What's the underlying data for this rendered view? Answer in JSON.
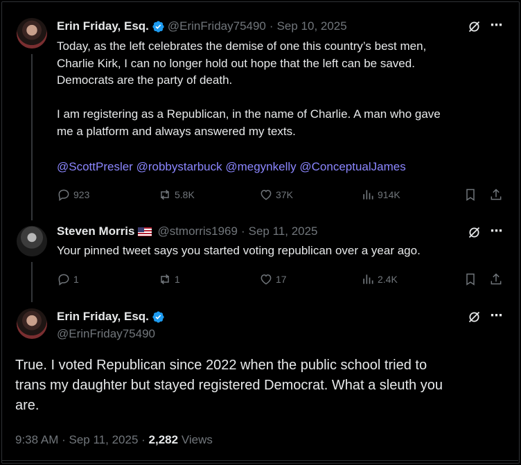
{
  "tweet1": {
    "name": "Erin Friday, Esq.",
    "handle": "@ErinFriday75490",
    "separator": "·",
    "date": "Sep 10, 2025",
    "lines": [
      "Today, as the left celebrates the demise of one this country’s best men,",
      "Charlie Kirk, I can no longer hold out hope that the left can be saved.",
      "Democrats are the party of death.",
      "",
      "I am registering as a Republican, in the name of Charlie.  A man who gave",
      "me a platform and always answered my texts."
    ],
    "mentions": [
      "@ScottPresler",
      "@robbystarbuck",
      "@megynkelly",
      "@ConceptualJames"
    ],
    "replies": "923",
    "reposts": "5.8K",
    "likes": "37K",
    "views": "914K"
  },
  "tweet2": {
    "name": "Steven Morris",
    "handle": "@stmorris1969",
    "separator": "·",
    "date": "Sep 11, 2025",
    "text": "Your pinned tweet says you started voting republican over a year ago.",
    "replies": "1",
    "reposts": "1",
    "likes": "17",
    "views": "2.4K"
  },
  "tweet3": {
    "name": "Erin Friday, Esq.",
    "handle": "@ErinFriday75490",
    "lines": [
      "True.  I voted Republican since 2022 when the public school tried to",
      "trans my daughter but stayed registered Democrat.  What a sleuth you",
      "are."
    ],
    "time": "9:38 AM",
    "separator": "·",
    "date": "Sep 11, 2025",
    "views_count": "2,282",
    "views_label": "Views"
  },
  "icons": {
    "more": "⋯",
    "verified_color": "#1d9bf0",
    "mention_color": "#8b86ff"
  }
}
